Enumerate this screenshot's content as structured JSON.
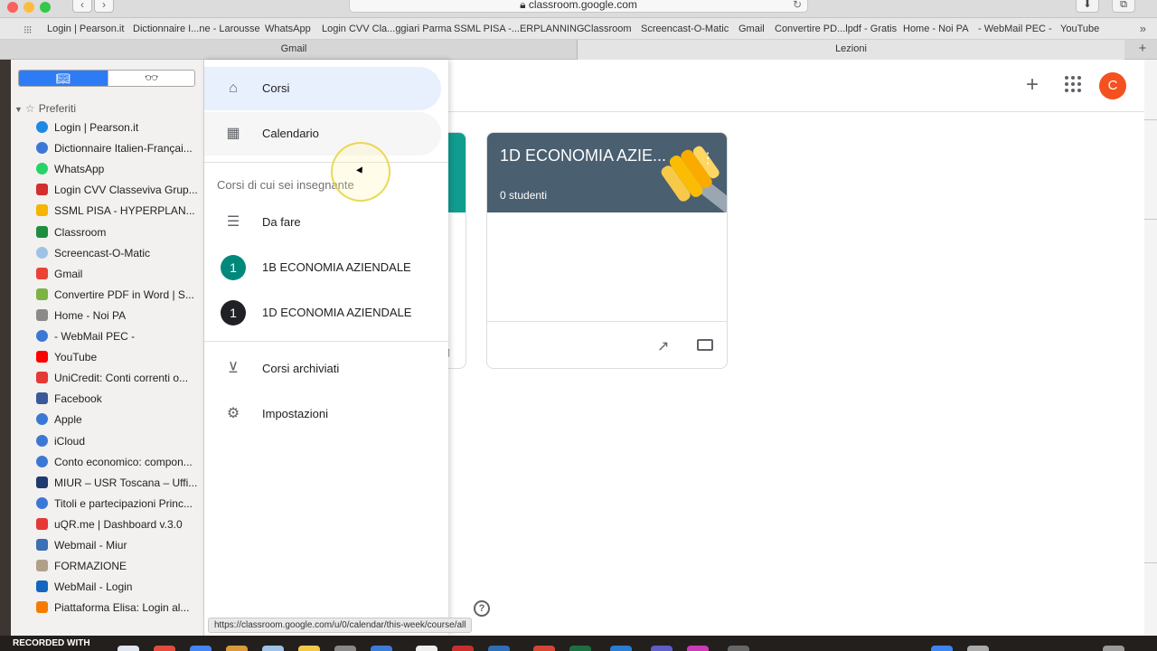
{
  "browser": {
    "url": "classroom.google.com",
    "favorites_bar": [
      "Login | Pearson.it",
      "Dictionnaire I...ne - Larousse",
      "WhatsApp",
      "Login CVV Cla...ggiari Parma",
      "SSML PISA -...ERPLANNING",
      "Classroom",
      "Screencast-O-Matic",
      "Gmail",
      "Convertire PD...lpdf - Gratis",
      "Home - Noi PA",
      "- WebMail PEC -",
      "YouTube"
    ],
    "tabs": [
      "Gmail",
      "Lezioni"
    ],
    "status_url": "https://classroom.google.com/u/0/calendar/this-week/course/all"
  },
  "sidebar": {
    "header": "Preferiti",
    "bookmarks": [
      {
        "label": "Login | Pearson.it",
        "icon": "pearson-icon",
        "color": "#1e88e5"
      },
      {
        "label": "Dictionnaire Italien-Françai...",
        "icon": "globe-icon",
        "color": "#3b78d6"
      },
      {
        "label": "WhatsApp",
        "icon": "whatsapp-icon",
        "color": "#25d366"
      },
      {
        "label": "Login CVV Classeviva Grup...",
        "icon": "classeviva-icon",
        "color": "#d32f2f"
      },
      {
        "label": "SSML PISA - HYPERPLAN...",
        "icon": "hyperplanning-icon",
        "color": "#f4b400"
      },
      {
        "label": "Classroom",
        "icon": "classroom-icon",
        "color": "#1e8e3e"
      },
      {
        "label": "Screencast-O-Matic",
        "icon": "screencast-icon",
        "color": "#9ec3e6"
      },
      {
        "label": "Gmail",
        "icon": "google-icon",
        "color": "#ea4335"
      },
      {
        "label": "Convertire PDF in Word | S...",
        "icon": "pdf-icon",
        "color": "#7cb342"
      },
      {
        "label": "Home - Noi PA",
        "icon": "noipa-icon",
        "color": "#8a8a8a"
      },
      {
        "label": "- WebMail PEC -",
        "icon": "globe-icon",
        "color": "#3b78d6"
      },
      {
        "label": "YouTube",
        "icon": "youtube-icon",
        "color": "#ff0000"
      },
      {
        "label": "UniCredit: Conti correnti o...",
        "icon": "unicredit-icon",
        "color": "#e53935"
      },
      {
        "label": "Facebook",
        "icon": "facebook-icon",
        "color": "#3b5998"
      },
      {
        "label": "Apple",
        "icon": "globe-icon",
        "color": "#3b78d6"
      },
      {
        "label": "iCloud",
        "icon": "globe-icon",
        "color": "#3b78d6"
      },
      {
        "label": "Conto economico: compon...",
        "icon": "globe-icon",
        "color": "#3b78d6"
      },
      {
        "label": "MIUR – USR Toscana – Uffi...",
        "icon": "miur-icon",
        "color": "#1f3a6e"
      },
      {
        "label": "Titoli e partecipazioni Princ...",
        "icon": "globe-icon",
        "color": "#3b78d6"
      },
      {
        "label": "uQR.me | Dashboard v.3.0",
        "icon": "uqr-icon",
        "color": "#e53935"
      },
      {
        "label": "Webmail - Miur",
        "icon": "webmail-icon",
        "color": "#3b6fb6"
      },
      {
        "label": "FORMAZIONE",
        "icon": "formazione-icon",
        "color": "#b0a08a"
      },
      {
        "label": "WebMail - Login",
        "icon": "webmail-login-icon",
        "color": "#1565c0"
      },
      {
        "label": "Piattaforma Elisa: Login al...",
        "icon": "elisa-icon",
        "color": "#f57c00"
      }
    ]
  },
  "drawer": {
    "items": [
      {
        "label": "Corsi",
        "icon": "home-icon"
      },
      {
        "label": "Calendario",
        "icon": "calendar-icon"
      }
    ],
    "section_title": "Corsi di cui sei insegnante",
    "todo": "Da fare",
    "courses": [
      {
        "label": "1B ECONOMIA AZIENDALE",
        "badge": "1",
        "color": "#00897b"
      },
      {
        "label": "1D ECONOMIA AZIENDALE",
        "badge": "1",
        "color": "#202124"
      }
    ],
    "archived": "Corsi archiviati",
    "settings": "Impostazioni"
  },
  "header": {
    "avatar_letter": "C",
    "avatar_color": "#f4511e"
  },
  "course_card": {
    "title": "1D ECONOMIA AZIE...",
    "students": "0 studenti",
    "band_color": "#4a5f70"
  },
  "recorder": {
    "label": "RECORDED WITH"
  }
}
